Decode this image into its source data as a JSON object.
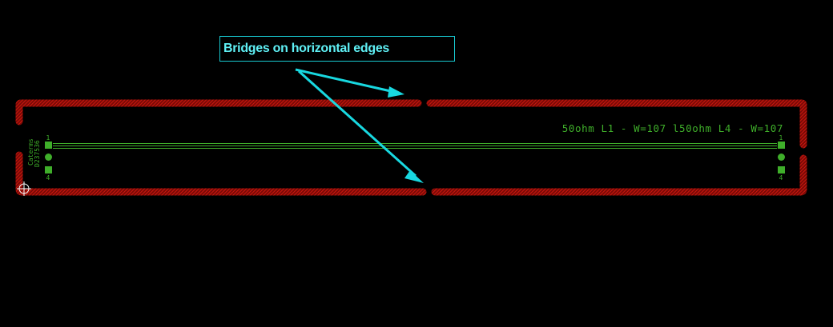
{
  "annotation": {
    "label": "Bridges on horizontal edges"
  },
  "board": {
    "trace_label": "50ohm L1 - W=107 l50ohm L4 - W=107",
    "component_ref": "Caterms",
    "component_value": "D237536",
    "left_pin_top": "1",
    "left_pin_bottom": "4",
    "right_pin_top": "1",
    "right_pin_bottom": "4"
  },
  "colors": {
    "background": "#000000",
    "outline": "#c0140e",
    "copper": "#3fae2a",
    "annotation": "#18c8d0"
  }
}
